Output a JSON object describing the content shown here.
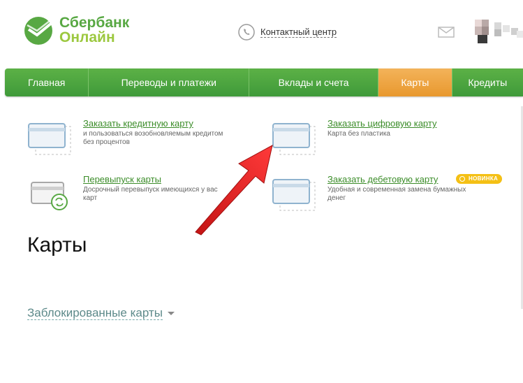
{
  "header": {
    "logo_line1": "Сбербанк",
    "logo_line2": "Онлайн",
    "contact_label": "Контактный центр"
  },
  "nav": {
    "items": [
      {
        "label": "Главная"
      },
      {
        "label": "Переводы и платежи"
      },
      {
        "label": "Вклады и счета"
      },
      {
        "label": "Карты",
        "active": true
      },
      {
        "label": "Кредиты"
      }
    ]
  },
  "tiles": [
    {
      "title": "Заказать кредитную карту",
      "desc": "и пользоваться возобновляемым кредитом без процентов"
    },
    {
      "title": "Заказать цифровую карту",
      "desc": "Карта без пластика"
    },
    {
      "title": "Перевыпуск карты",
      "desc": "Досрочный перевыпуск имеющихся у вас карт"
    },
    {
      "title": "Заказать дебетовую карту",
      "desc": "Удобная и современная замена бумажных денег",
      "badge": "НОВИНКА"
    }
  ],
  "page": {
    "title": "Карты",
    "blocked_label": "Заблокированные карты"
  },
  "colors": {
    "brand_green": "#58a843",
    "nav_active": "#f0a843",
    "link_green": "#3c8d2a",
    "badge": "#f4c015",
    "annotation_arrow": "#e02020"
  }
}
